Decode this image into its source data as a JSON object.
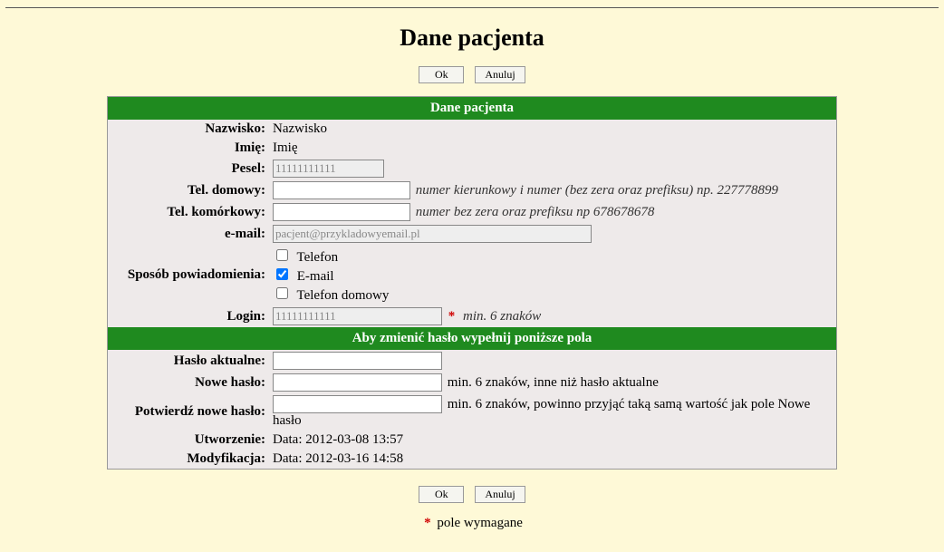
{
  "page_title": "Dane pacjenta",
  "buttons": {
    "ok": "Ok",
    "cancel": "Anuluj"
  },
  "section_main": "Dane pacjenta",
  "section_password": "Aby zmienić hasło wypełnij poniższe pola",
  "labels": {
    "lastname": "Nazwisko:",
    "firstname": "Imię:",
    "pesel": "Pesel:",
    "home_phone": "Tel. domowy:",
    "mobile_phone": "Tel. komórkowy:",
    "email": "e-mail:",
    "notify_method": "Sposób powiadomienia:",
    "login": "Login:",
    "current_password": "Hasło aktualne:",
    "new_password": "Nowe hasło:",
    "confirm_password": "Potwierdź nowe hasło:",
    "created": "Utworzenie:",
    "modified": "Modyfikacja:"
  },
  "values": {
    "lastname": "Nazwisko",
    "firstname": "Imię",
    "pesel": "11111111111",
    "home_phone": "",
    "mobile_phone": "",
    "email": "pacjent@przykladowyemail.pl",
    "login": "11111111111",
    "created": "Data: 2012-03-08 13:57",
    "modified": "Data: 2012-03-16 14:58"
  },
  "hints": {
    "home_phone": "numer kierunkowy i numer (bez zera oraz prefiksu) np. 227778899",
    "mobile_phone": "numer bez zera oraz prefiksu np 678678678",
    "login": "min. 6 znaków",
    "new_password": "min. 6 znaków, inne niż hasło aktualne",
    "confirm_password": "min. 6 znaków, powinno przyjąć taką samą wartość jak pole Nowe hasło"
  },
  "notify_options": {
    "phone": "Telefon",
    "email": "E-mail",
    "home_phone": "Telefon domowy"
  },
  "notify_selected": {
    "phone": false,
    "email": true,
    "home_phone": false
  },
  "required_marker": "*",
  "required_note": "pole wymagane"
}
